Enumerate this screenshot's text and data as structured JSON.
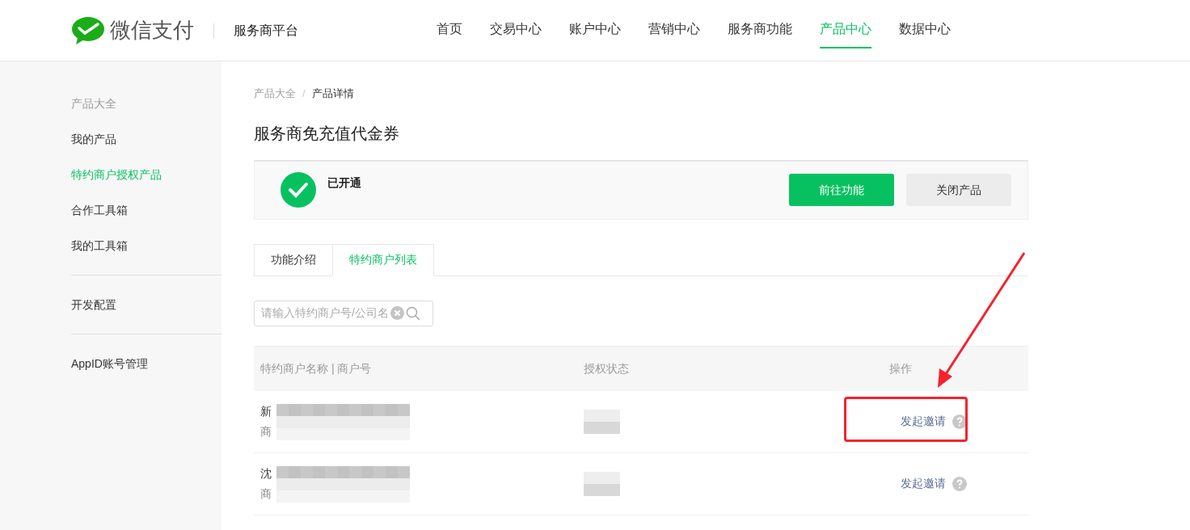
{
  "header": {
    "logo_text": "微信支付",
    "platform": "服务商平台",
    "nav": [
      {
        "label": "首页",
        "selected": false
      },
      {
        "label": "交易中心",
        "selected": false
      },
      {
        "label": "账户中心",
        "selected": false
      },
      {
        "label": "营销中心",
        "selected": false
      },
      {
        "label": "服务商功能",
        "selected": false
      },
      {
        "label": "产品中心",
        "selected": true
      },
      {
        "label": "数据中心",
        "selected": false
      }
    ]
  },
  "sidebar": {
    "groups": [
      [
        {
          "label": "产品大全",
          "kind": "heading"
        },
        {
          "label": "我的产品",
          "kind": "item",
          "selected": false
        },
        {
          "label": "特约商户授权产品",
          "kind": "item",
          "selected": true
        },
        {
          "label": "合作工具箱",
          "kind": "item",
          "selected": false
        },
        {
          "label": "我的工具箱",
          "kind": "item",
          "selected": false
        }
      ],
      [
        {
          "label": "开发配置",
          "kind": "item",
          "selected": false
        }
      ],
      [
        {
          "label": "AppID账号管理",
          "kind": "item",
          "selected": false
        }
      ]
    ]
  },
  "breadcrumb": {
    "items": [
      "产品大全",
      "产品详情"
    ],
    "separator": "/"
  },
  "title": "服务商免充值代金券",
  "status_card": {
    "status": "已开通",
    "buttons": [
      {
        "label": "前往功能",
        "kind": "primary"
      },
      {
        "label": "关闭产品",
        "kind": "secondary"
      }
    ]
  },
  "tabs": [
    {
      "label": "功能介绍",
      "selected": false
    },
    {
      "label": "特约商户列表",
      "selected": true
    }
  ],
  "search": {
    "placeholder": "请输入特约商户号/公司名"
  },
  "table": {
    "columns": [
      "特约商户名称 | 商户号",
      "授权状态",
      "操作"
    ],
    "rows": [
      {
        "name": "新",
        "number": "商",
        "action": "发起邀请",
        "highlighted": true
      },
      {
        "name": "沈",
        "number": "商",
        "action": "发起邀请",
        "highlighted": false
      }
    ]
  }
}
